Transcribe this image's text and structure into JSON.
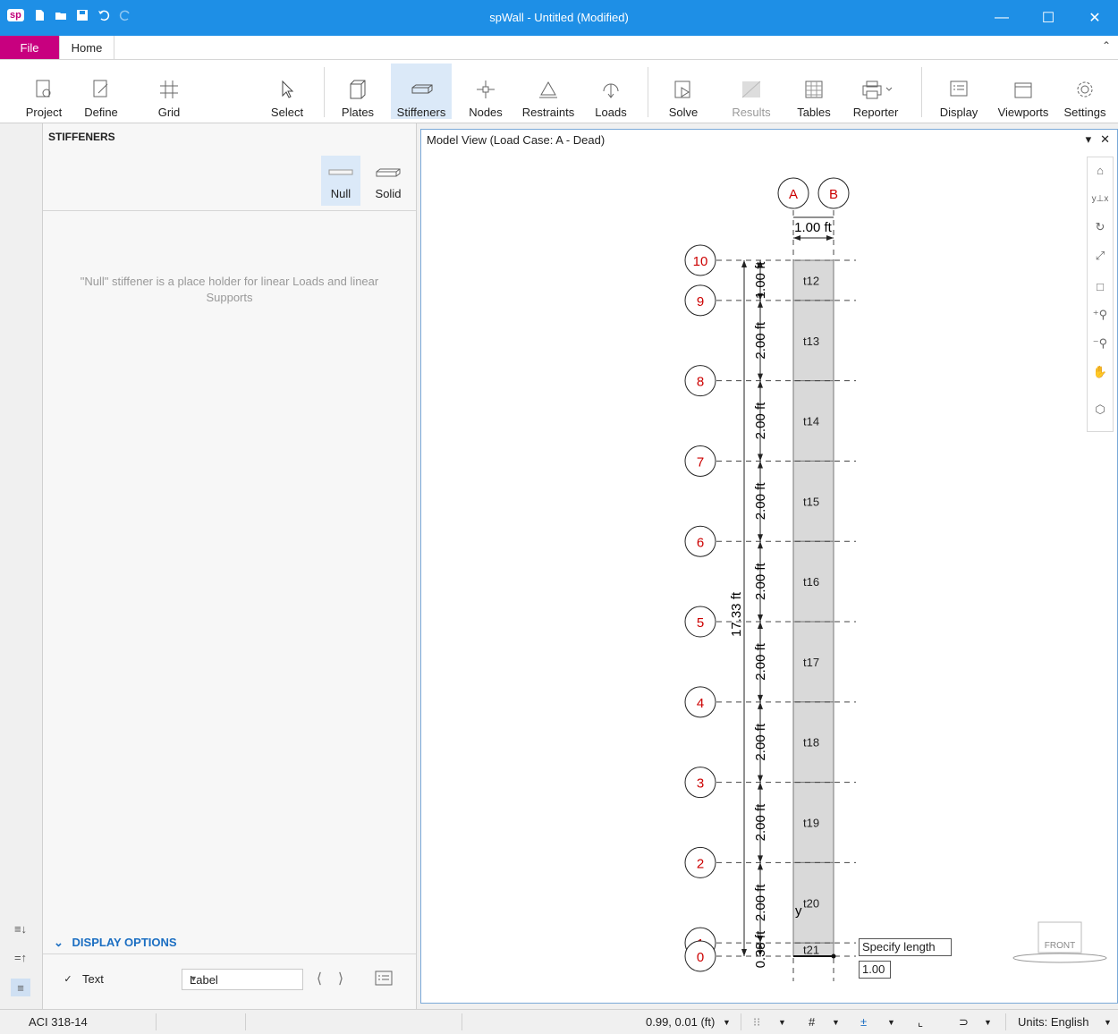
{
  "app": {
    "logo": "sp",
    "title": "spWall - Untitled (Modified)",
    "window_controls": [
      "minimize-icon",
      "maximize-icon",
      "close-icon"
    ]
  },
  "tabs": {
    "file": "File",
    "home": "Home"
  },
  "ribbon": {
    "project": "Project",
    "define": "Define",
    "grid": "Grid",
    "select": "Select",
    "plates": "Plates",
    "stiffeners": "Stiffeners",
    "nodes": "Nodes",
    "restraints": "Restraints",
    "loads": "Loads",
    "solve": "Solve",
    "results": "Results",
    "tables": "Tables",
    "reporter": "Reporter",
    "display": "Display",
    "viewports": "Viewports",
    "settings": "Settings",
    "active": "Stiffeners"
  },
  "panel": {
    "title": "STIFFENERS",
    "types": {
      "null": "Null",
      "solid": "Solid",
      "selected": "Null"
    },
    "note": "\"Null\" stiffener is a place holder for linear Loads and linear Supports",
    "display_options": {
      "header": "DISPLAY OPTIONS",
      "text_label": "Text",
      "text_checked": true,
      "label_select": "Label"
    }
  },
  "model_view": {
    "title": "Model View (Load Case: A - Dead)",
    "grid_cols": [
      "A",
      "B"
    ],
    "width_dim": "1.00 ft",
    "total_dim": "17.33 ft",
    "rows": [
      {
        "label": "10"
      },
      {
        "label": "9"
      },
      {
        "label": "8"
      },
      {
        "label": "7"
      },
      {
        "label": "6"
      },
      {
        "label": "5"
      },
      {
        "label": "4"
      },
      {
        "label": "3"
      },
      {
        "label": "2"
      },
      {
        "label": "1"
      },
      {
        "label": "0"
      }
    ],
    "segments": [
      {
        "dim": "1.00 ft",
        "plate": "t12"
      },
      {
        "dim": "2.00 ft",
        "plate": "t13"
      },
      {
        "dim": "2.00 ft",
        "plate": "t14"
      },
      {
        "dim": "2.00 ft",
        "plate": "t15"
      },
      {
        "dim": "2.00 ft",
        "plate": "t16"
      },
      {
        "dim": "2.00 ft",
        "plate": "t17"
      },
      {
        "dim": "2.00 ft",
        "plate": "t18"
      },
      {
        "dim": "2.00 ft",
        "plate": "t19"
      },
      {
        "dim": "2.00 ft",
        "plate": "t20"
      },
      {
        "dim": "0.33 ft",
        "plate": "t21"
      }
    ],
    "axis_label": "y",
    "prompt": "Specify length",
    "prompt_value": "1.00",
    "cube_face": "FRONT"
  },
  "status": {
    "code": "ACI 318-14",
    "coords": "0.99, 0.01 (ft)",
    "units": "Units:  English"
  },
  "colors": {
    "titlebar": "#1e8fe6",
    "file_tab": "#c8007f",
    "grid_label": "#cc0000",
    "panel_header": "#1b6ec2",
    "plate_fill": "#d9d9d9"
  }
}
